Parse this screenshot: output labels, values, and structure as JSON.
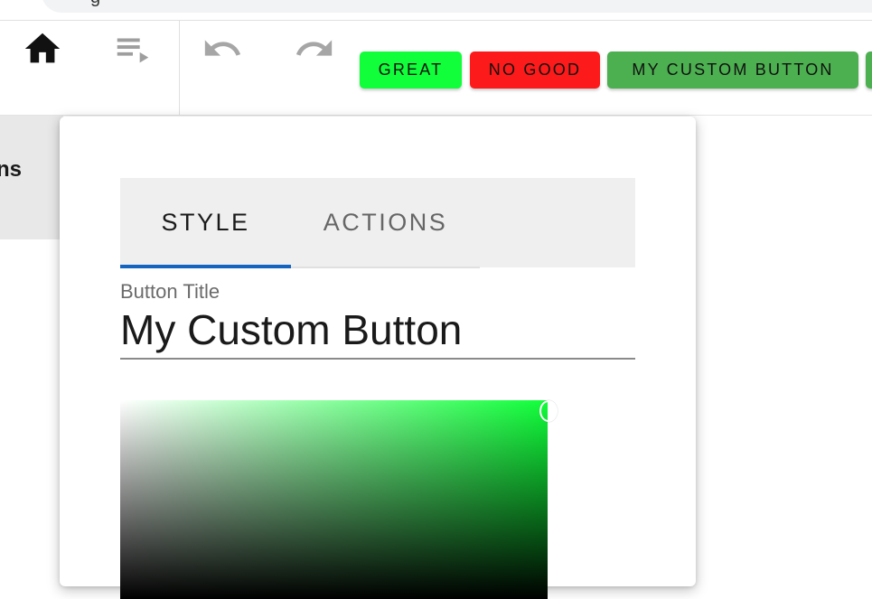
{
  "browser": {
    "search_text": "g"
  },
  "toolbar": {
    "icons": [
      "home-icon",
      "queue-icon",
      "undo-icon",
      "redo-icon"
    ],
    "buttons": {
      "great": {
        "label": "GREAT",
        "color": "#10ff3a"
      },
      "no_good": {
        "label": "NO GOOD",
        "color": "#fd1a1a"
      },
      "custom": {
        "label": "MY CUSTOM BUTTON",
        "color": "#4caf50"
      }
    }
  },
  "sidebar": {
    "partial_text": "ns"
  },
  "dialog": {
    "tabs": [
      {
        "label": "STYLE",
        "active": true
      },
      {
        "label": "ACTIONS",
        "active": false
      }
    ],
    "accent_color": "#1565c0",
    "field": {
      "label": "Button Title",
      "value": "My Custom Button"
    },
    "color_picker": {
      "selected_color": "#10ff3a"
    }
  }
}
